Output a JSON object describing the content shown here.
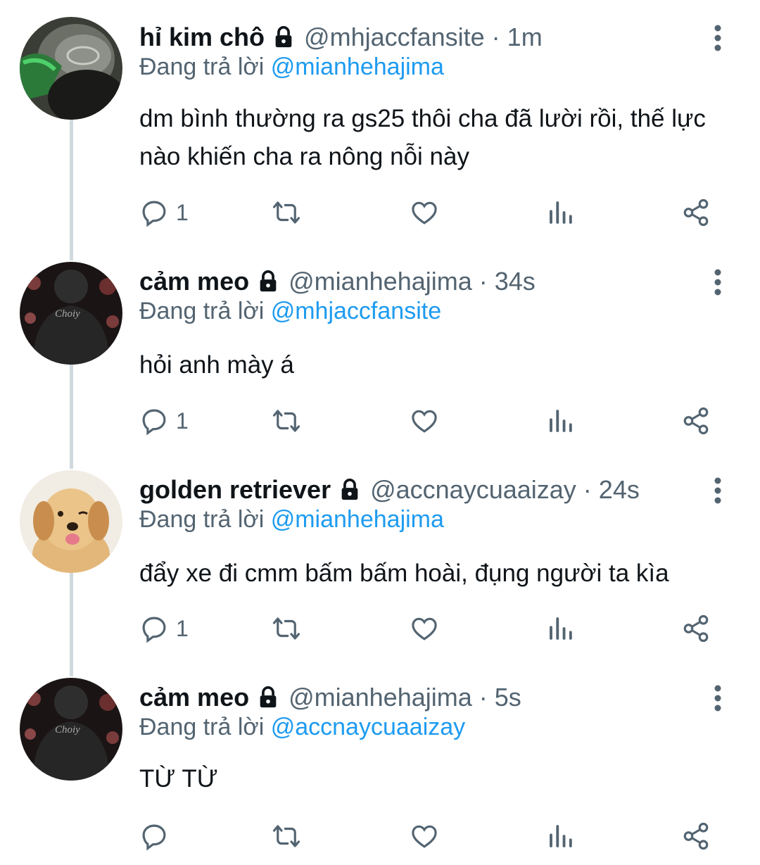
{
  "tweets": [
    {
      "name": "hỉ kim chô",
      "handle": "@mhjaccfansite",
      "separator": "·",
      "time": "1m",
      "replying_prefix": "Đang trả lời",
      "replying_to": "@mianhehajima",
      "text_lines": [
        "dm bình thường ra gs25 thôi cha đã lười rồi, thế lực",
        "nào khiến cha ra nông nỗi này"
      ],
      "reply_count": "1"
    },
    {
      "name": "cảm meo",
      "handle": "@mianhehajima",
      "separator": "·",
      "time": "34s",
      "replying_prefix": "Đang trả lời",
      "replying_to": "@mhjaccfansite",
      "text_lines": [
        "hỏi anh mày á"
      ],
      "reply_count": "1"
    },
    {
      "name": "golden retriever",
      "handle": "@accnaycuaaizay",
      "separator": "·",
      "time": "24s",
      "replying_prefix": "Đang trả lời",
      "replying_to": "@mianhehajima",
      "text_lines": [
        "đẩy xe đi cmm bấm bấm hoài, đụng người ta kìa"
      ],
      "reply_count": "1"
    },
    {
      "name": "cảm meo",
      "handle": "@mianhehajima",
      "separator": "·",
      "time": "5s",
      "replying_prefix": "Đang trả lời",
      "replying_to": "@accnaycuaaizay",
      "text_lines": [
        "TỪ TỪ"
      ],
      "reply_count": ""
    }
  ],
  "icons": {
    "reply": "reply-icon",
    "retweet": "retweet-icon",
    "like": "like-icon",
    "views": "views-icon",
    "share": "share-icon",
    "more": "more-icon",
    "lock": "lock-icon"
  },
  "colors": {
    "text": "#0f1419",
    "secondary": "#536471",
    "accent": "#1d9bf0",
    "thread_line": "#cfd9de"
  },
  "avatar_text": "Choiy"
}
